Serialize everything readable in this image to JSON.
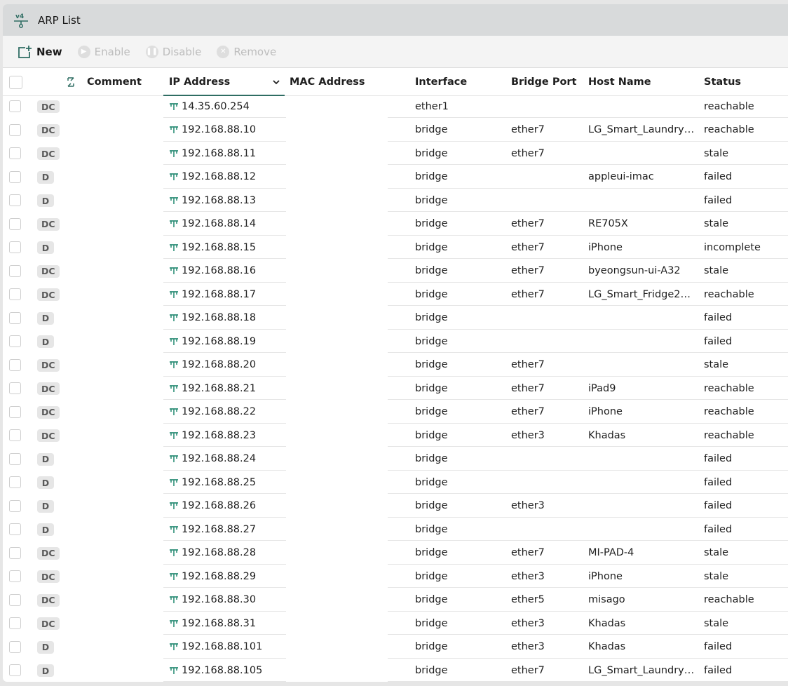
{
  "window": {
    "title": "ARP List",
    "title_icon": "ipv4-network-icon"
  },
  "toolbar": {
    "new_label": "New",
    "enable_label": "Enable",
    "disable_label": "Disable",
    "remove_label": "Remove"
  },
  "columns": {
    "comment": "Comment",
    "ip": "IP Address",
    "mac": "MAC Address",
    "interface": "Interface",
    "bridge_port": "Bridge Port",
    "host_name": "Host Name",
    "status": "Status"
  },
  "rows": [
    {
      "flag": "DC",
      "ip": "14.35.60.254",
      "iface": "ether1",
      "port": "",
      "host": "",
      "status": "reachable"
    },
    {
      "flag": "DC",
      "ip": "192.168.88.10",
      "iface": "bridge",
      "port": "ether7",
      "host": "LG_Smart_Laundry…",
      "status": "reachable"
    },
    {
      "flag": "DC",
      "ip": "192.168.88.11",
      "iface": "bridge",
      "port": "ether7",
      "host": "",
      "status": "stale"
    },
    {
      "flag": "D",
      "ip": "192.168.88.12",
      "iface": "bridge",
      "port": "",
      "host": "appleui-imac",
      "status": "failed"
    },
    {
      "flag": "D",
      "ip": "192.168.88.13",
      "iface": "bridge",
      "port": "",
      "host": "",
      "status": "failed"
    },
    {
      "flag": "DC",
      "ip": "192.168.88.14",
      "iface": "bridge",
      "port": "ether7",
      "host": "RE705X",
      "status": "stale"
    },
    {
      "flag": "D",
      "ip": "192.168.88.15",
      "iface": "bridge",
      "port": "ether7",
      "host": "iPhone",
      "status": "incomplete"
    },
    {
      "flag": "DC",
      "ip": "192.168.88.16",
      "iface": "bridge",
      "port": "ether7",
      "host": "byeongsun-ui-A32",
      "status": "stale"
    },
    {
      "flag": "DC",
      "ip": "192.168.88.17",
      "iface": "bridge",
      "port": "ether7",
      "host": "LG_Smart_Fridge2…",
      "status": "reachable"
    },
    {
      "flag": "D",
      "ip": "192.168.88.18",
      "iface": "bridge",
      "port": "",
      "host": "",
      "status": "failed"
    },
    {
      "flag": "D",
      "ip": "192.168.88.19",
      "iface": "bridge",
      "port": "",
      "host": "",
      "status": "failed"
    },
    {
      "flag": "DC",
      "ip": "192.168.88.20",
      "iface": "bridge",
      "port": "ether7",
      "host": "",
      "status": "stale"
    },
    {
      "flag": "DC",
      "ip": "192.168.88.21",
      "iface": "bridge",
      "port": "ether7",
      "host": "iPad9",
      "status": "reachable"
    },
    {
      "flag": "DC",
      "ip": "192.168.88.22",
      "iface": "bridge",
      "port": "ether7",
      "host": "iPhone",
      "status": "reachable"
    },
    {
      "flag": "DC",
      "ip": "192.168.88.23",
      "iface": "bridge",
      "port": "ether3",
      "host": "Khadas",
      "status": "reachable"
    },
    {
      "flag": "D",
      "ip": "192.168.88.24",
      "iface": "bridge",
      "port": "",
      "host": "",
      "status": "failed"
    },
    {
      "flag": "D",
      "ip": "192.168.88.25",
      "iface": "bridge",
      "port": "",
      "host": "",
      "status": "failed"
    },
    {
      "flag": "D",
      "ip": "192.168.88.26",
      "iface": "bridge",
      "port": "ether3",
      "host": "",
      "status": "failed"
    },
    {
      "flag": "D",
      "ip": "192.168.88.27",
      "iface": "bridge",
      "port": "",
      "host": "",
      "status": "failed"
    },
    {
      "flag": "DC",
      "ip": "192.168.88.28",
      "iface": "bridge",
      "port": "ether7",
      "host": "MI-PAD-4",
      "status": "stale"
    },
    {
      "flag": "DC",
      "ip": "192.168.88.29",
      "iface": "bridge",
      "port": "ether3",
      "host": "iPhone",
      "status": "stale"
    },
    {
      "flag": "DC",
      "ip": "192.168.88.30",
      "iface": "bridge",
      "port": "ether5",
      "host": "misago",
      "status": "reachable"
    },
    {
      "flag": "DC",
      "ip": "192.168.88.31",
      "iface": "bridge",
      "port": "ether3",
      "host": "Khadas",
      "status": "stale"
    },
    {
      "flag": "D",
      "ip": "192.168.88.101",
      "iface": "bridge",
      "port": "ether3",
      "host": "Khadas",
      "status": "failed"
    },
    {
      "flag": "D",
      "ip": "192.168.88.105",
      "iface": "bridge",
      "port": "ether7",
      "host": "LG_Smart_Laundry…",
      "status": "failed"
    }
  ],
  "colors": {
    "accent": "#2f6d63",
    "badge_bg": "#e6e6e6",
    "pin": "#2f8f78"
  }
}
